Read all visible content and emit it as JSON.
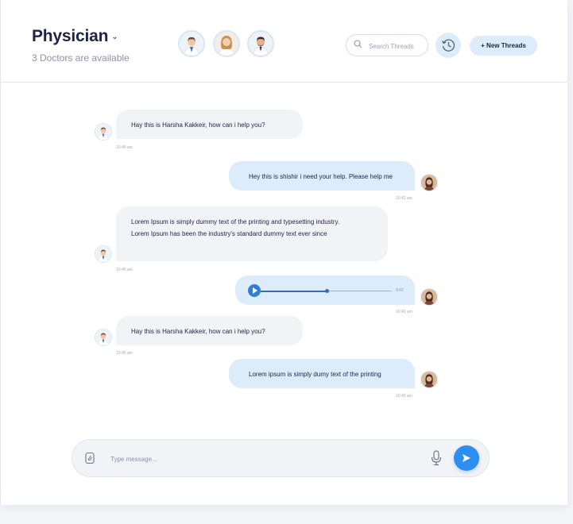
{
  "header": {
    "title": "Physician",
    "subtitle": "3 Doctors are available",
    "doctors": [
      "doctor-male-1",
      "doctor-female",
      "doctor-male-2"
    ],
    "search_placeholder": "Search Threads",
    "new_thread_label": "+ New Threads"
  },
  "messages": [
    {
      "direction": "in",
      "text": "Hay this is Harsha Kakkeir, how can i help you?",
      "time": "10:45 am"
    },
    {
      "direction": "out",
      "text": "Hey this is shishir i need your help. Please help me",
      "time": "10:42 am"
    },
    {
      "direction": "in",
      "lines": [
        "Lorem Ipsum is simply dummy text of the printing and typesetting industry.",
        "Lorem Ipsum has been the industry's standard dummy text ever since"
      ],
      "time": "10:45 am"
    },
    {
      "direction": "out",
      "type": "audio",
      "duration": "0:42",
      "progress": 0.5,
      "time": "10:42 am"
    },
    {
      "direction": "in",
      "text": "Hay this is Harsha Kakkeir, how can i help you?",
      "time": "10:45 am"
    },
    {
      "direction": "out",
      "text": "Lorem ipsum is simply dumy text of the printing",
      "time": "10:40 am"
    }
  ],
  "composer": {
    "placeholder": "Type message..."
  },
  "colors": {
    "accent": "#2d8ef2",
    "outgoing_bubble": "#dcecfb",
    "incoming_bubble": "#f1f3f6",
    "title": "#1d2444"
  },
  "icons": {
    "search": "search-icon",
    "history": "history-icon",
    "attach": "attachment-icon",
    "mic": "microphone-icon",
    "send": "send-icon",
    "dropdown": "chevron-down-icon",
    "play": "play-icon"
  }
}
